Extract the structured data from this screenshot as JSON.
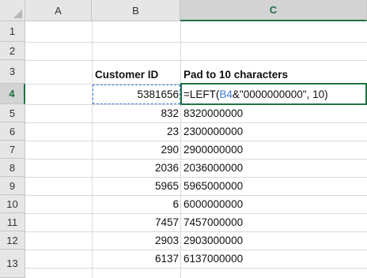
{
  "columns": [
    "A",
    "B",
    "C"
  ],
  "rows": [
    "1",
    "2",
    "3",
    "4",
    "5",
    "6",
    "7",
    "8",
    "9",
    "10",
    "11",
    "12",
    "13"
  ],
  "header": {
    "b": "Customer ID",
    "c": "Pad to 10 characters"
  },
  "formula": {
    "prefix": "=LEFT(",
    "ref": "B4",
    "suffix": "&\"0000000000\", 10)"
  },
  "data_rows": [
    {
      "row": "4",
      "id": "5381656",
      "padded": ""
    },
    {
      "row": "5",
      "id": "832",
      "padded": "8320000000"
    },
    {
      "row": "6",
      "id": "23",
      "padded": "2300000000"
    },
    {
      "row": "7",
      "id": "290",
      "padded": "2900000000"
    },
    {
      "row": "8",
      "id": "2036",
      "padded": "2036000000"
    },
    {
      "row": "9",
      "id": "5965",
      "padded": "5965000000"
    },
    {
      "row": "10",
      "id": "6",
      "padded": "6000000000"
    },
    {
      "row": "11",
      "id": "7457",
      "padded": "7457000000"
    },
    {
      "row": "12",
      "id": "2903",
      "padded": "2903000000"
    },
    {
      "row": "13",
      "id": "6137",
      "padded": "6137000000"
    }
  ],
  "colors": {
    "active_green": "#217346",
    "ref_blue": "#3b7dd8",
    "header_gray": "#e6e6e6"
  }
}
